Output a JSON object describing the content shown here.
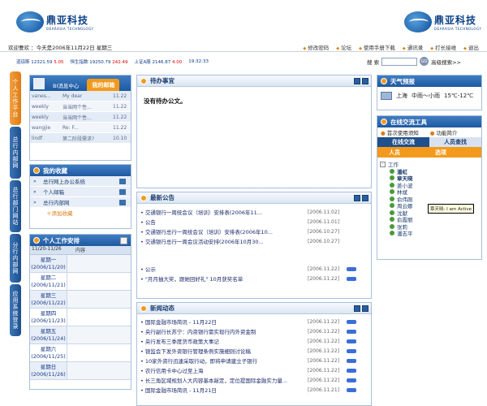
{
  "brand": {
    "name_cn": "鼎亚科技",
    "name_en": "DEARASIA TECHNOLOGY"
  },
  "infobar": {
    "welcome": "欢迎曹欢 ：今天是2006年11月22日 星期三",
    "links": [
      "修改密码",
      "论坛",
      "使用手册下载",
      "通讯录",
      "打长接维",
      "退出"
    ]
  },
  "ticker": [
    {
      "label": "道琼斯",
      "value": "12321.59",
      "change": "5.05"
    },
    {
      "label": "恒生指数",
      "value": "19250.79",
      "change": "242.49"
    },
    {
      "label": "上证A股",
      "value": "2146.87",
      "change": "4.00"
    },
    {
      "label": "",
      "value": "19:32:33",
      "change": ""
    }
  ],
  "search": {
    "label": "搜 索",
    "button": "GO",
    "advanced": "高级搜索>>"
  },
  "vtabs": [
    "个人工作平台",
    "总行内部网",
    "总行部门网站",
    "分行内部网",
    "应用系统登录"
  ],
  "mail_panel": {
    "tab1": "BI消息中心",
    "tab2": "我的邮箱",
    "rows": [
      {
        "from": "vanes...",
        "subject": "My dear",
        "date": "11.22"
      },
      {
        "from": "weekly",
        "subject": "当当网个性...",
        "date": "11.22"
      },
      {
        "from": "weekly",
        "subject": "当当网个性...",
        "date": "11.22"
      },
      {
        "from": "wangjie",
        "subject": "Re: F...",
        "date": "11.22"
      },
      {
        "from": "lindf",
        "subject": "第二阶段需求?",
        "date": "10.10"
      }
    ]
  },
  "favorites": {
    "title": "我的收藏",
    "items": [
      "总行网上办公系统",
      "个人邮箱",
      "总行内部网"
    ],
    "add": "添加收藏"
  },
  "schedule": {
    "title": "个人工作安排",
    "range": "11/20-11/26",
    "col": "内容",
    "days": [
      {
        "day": "星期一",
        "date": "(2006/11/20)"
      },
      {
        "day": "星期二",
        "date": "(2006/11/21)"
      },
      {
        "day": "星期三",
        "date": "(2006/11/22)"
      },
      {
        "day": "星期四",
        "date": "(2006/11/23)"
      },
      {
        "day": "星期五",
        "date": "(2006/11/24)"
      },
      {
        "day": "星期六",
        "date": "(2006/11/25)"
      },
      {
        "day": "星期日",
        "date": "(2006/11/26)"
      }
    ]
  },
  "todo": {
    "title": "待办事宜",
    "empty": "没有待办公文。"
  },
  "notice": {
    "title": "最新公告",
    "items": [
      {
        "text": "• 交通银行一周统会议（培训）安排表(2006年11...",
        "date": "[2006.11.02]"
      },
      {
        "text": "• 公告",
        "date": "[2006.11.01]"
      },
      {
        "text": "• 交通银行总行一周统会议（培训）安排表(2006年10...",
        "date": "[2006.10.27]"
      },
      {
        "text": "• 交通银行总行一周会议活动安排(2006年10月30...",
        "date": "[2006.10.27]"
      },
      {
        "text": "• 公示",
        "date": "[2006.11.22]"
      },
      {
        "text": "• \"月月抽大奖，跟她回好礼\" 10月获奖名单",
        "date": "[2006.11.22]"
      }
    ]
  },
  "news": {
    "title": "新闻动态",
    "items": [
      {
        "text": "• 国际金融市场简讯 - 11月22日",
        "date": "[2006.11.22]"
      },
      {
        "text": "• 央行副行长苏宁：内资银行需实现行内外资金制",
        "date": "[2006.11.22]"
      },
      {
        "text": "• 央行发布三季度货币政策大事记",
        "date": "[2006.11.22]"
      },
      {
        "text": "• 银监会下发外资银行管理条例实施细则讨论稿",
        "date": "[2006.11.22]"
      },
      {
        "text": "• 10家外资行迅速采取行动，即将申请建立子银行",
        "date": "[2006.11.22]"
      },
      {
        "text": "• 农行信用卡中心过至上海",
        "date": "[2006.11.22]"
      },
      {
        "text": "• 长三角区域规划人大内容基本敲定，定位提国际金融实力量...",
        "date": "[2006.11.22]"
      },
      {
        "text": "• 国际金融市场简讯 - 11月21日",
        "date": "[2006.11.21]"
      }
    ]
  },
  "weather": {
    "title": "天气预报",
    "city": "上海",
    "desc": "中雨～小雨",
    "temp": "15℃-12℃"
  },
  "im": {
    "title": "在线交流工具",
    "help": "首次使用须知",
    "features": "功能简介",
    "tab_online": "在线交流",
    "tab_search": "人员查找",
    "col1": "人员",
    "col2": "选项",
    "group": "工作",
    "people": [
      "潘虹",
      "章天晓",
      "姜小波",
      "林斌",
      "俞伟刚",
      "周云娜",
      "沈献",
      "俞霞丽",
      "张莉",
      "潘志平"
    ],
    "tooltip": "章天晓: I am Active"
  }
}
